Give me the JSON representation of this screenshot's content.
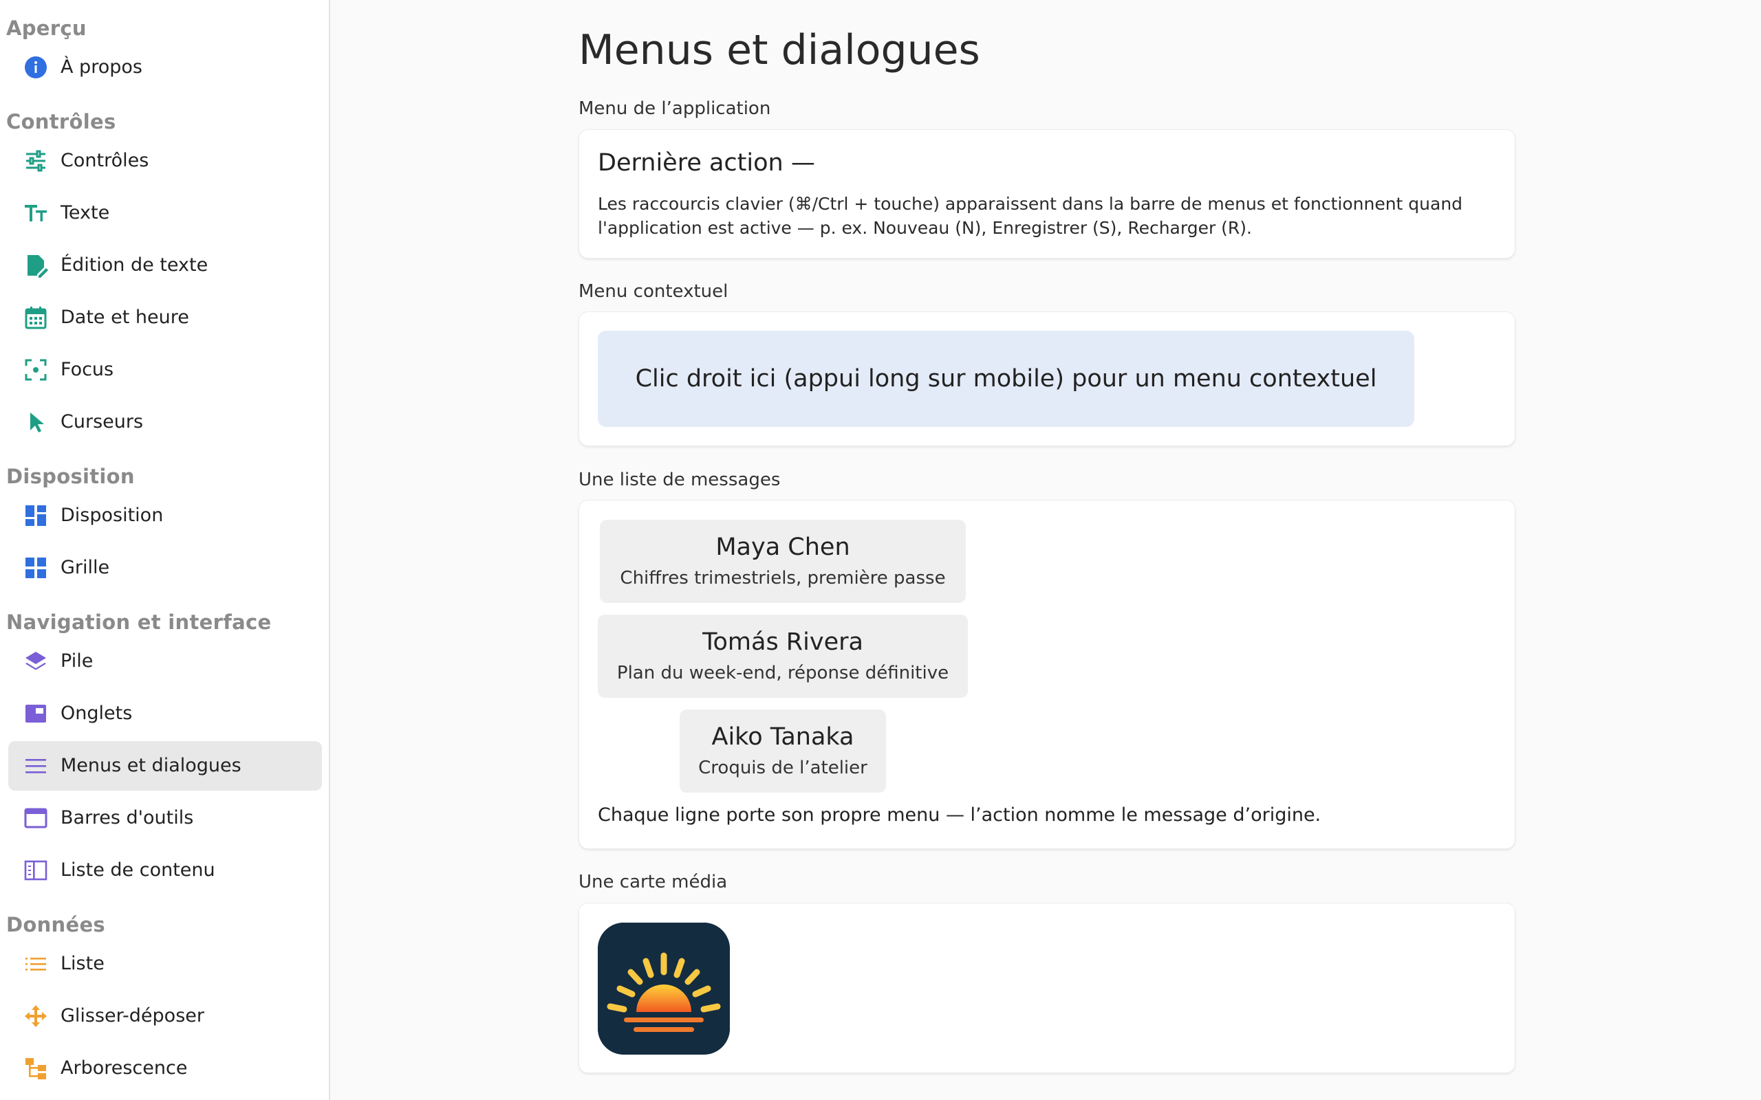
{
  "sidebar": {
    "sections": [
      {
        "title": "Aperçu",
        "items": [
          {
            "label": "À propos",
            "icon": "info-icon"
          }
        ]
      },
      {
        "title": "Contrôles",
        "items": [
          {
            "label": "Contrôles",
            "icon": "sliders-icon"
          },
          {
            "label": "Texte",
            "icon": "text-size-icon"
          },
          {
            "label": "Édition de texte",
            "icon": "doc-edit-icon"
          },
          {
            "label": "Date et heure",
            "icon": "calendar-icon"
          },
          {
            "label": "Focus",
            "icon": "focus-icon"
          },
          {
            "label": "Curseurs",
            "icon": "cursor-icon"
          }
        ]
      },
      {
        "title": "Disposition",
        "items": [
          {
            "label": "Disposition",
            "icon": "dashboard-icon"
          },
          {
            "label": "Grille",
            "icon": "grid-icon"
          }
        ]
      },
      {
        "title": "Navigation et interface",
        "items": [
          {
            "label": "Pile",
            "icon": "stack-icon"
          },
          {
            "label": "Onglets",
            "icon": "tabs-icon"
          },
          {
            "label": "Menus et dialogues",
            "icon": "menu-icon"
          },
          {
            "label": "Barres d'outils",
            "icon": "toolbar-icon"
          },
          {
            "label": "Liste de contenu",
            "icon": "content-list-icon"
          }
        ]
      },
      {
        "title": "Données",
        "items": [
          {
            "label": "Liste",
            "icon": "list-icon"
          },
          {
            "label": "Glisser-déposer",
            "icon": "move-icon"
          },
          {
            "label": "Arborescence",
            "icon": "tree-icon"
          }
        ]
      }
    ],
    "active_item": "Menus et dialogues"
  },
  "main": {
    "title": "Menus et dialogues",
    "app_menu": {
      "label": "Menu de l’application",
      "last_action": "Dernière action  —",
      "description": "Les raccourcis clavier (⌘/Ctrl + touche) apparaissent dans la barre de menus et fonctionnent quand l'application est active — p. ex. Nouveau (N), Enregistrer (S), Recharger (R)."
    },
    "context_menu": {
      "label": "Menu contextuel",
      "zone_text": "Clic droit ici (appui long sur mobile) pour un menu contextuel"
    },
    "message_list": {
      "label": "Une liste de messages",
      "messages": [
        {
          "name": "Maya Chen",
          "subject": "Chiffres trimestriels, première passe"
        },
        {
          "name": "Tomás Rivera",
          "subject": "Plan du week-end, réponse définitive"
        },
        {
          "name": "Aiko Tanaka",
          "subject": "Croquis de l’atelier"
        }
      ],
      "caption": "Chaque ligne porte son propre menu — l’action nomme le message d’origine."
    },
    "media_card": {
      "label": "Une carte média",
      "icon": "sunrise-app-icon"
    }
  },
  "colors": {
    "sidebar_green": "#1f9e86",
    "sidebar_blue": "#2f6fe0",
    "sidebar_purple": "#7a5fd6",
    "sidebar_orange": "#f0a030",
    "context_zone": "#e4ebf8",
    "media_bg": "#142c40"
  }
}
